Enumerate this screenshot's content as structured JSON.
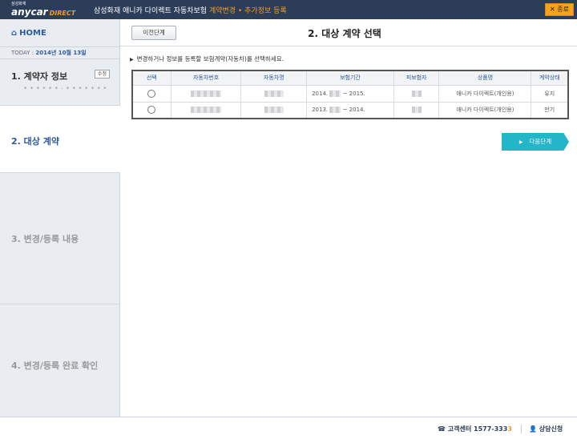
{
  "header": {
    "logo_top": "삼성화재",
    "logo_main": "anycar",
    "logo_sub": "DIRECT",
    "title": "삼성화재 애니카 다이렉트 자동차보험",
    "subtitle": "계약변경 • 추가정보 등록",
    "close_label": "종료"
  },
  "sidebar": {
    "home_label": "HOME",
    "today_label": "TODAY :",
    "today_date": "2014년 10월 13일",
    "steps": [
      {
        "label": "1. 계약자 정보",
        "badge": "수정",
        "masked": "* * * * * * · * * * * * * *"
      },
      {
        "label": "2. 대상 계약"
      },
      {
        "label": "3. 변경/등록 내용"
      },
      {
        "label": "4. 변경/등록 완료 확인"
      }
    ]
  },
  "main": {
    "prev_label": "이전단계",
    "title": "2. 대상 계약 선택",
    "instruction": "변경하거나 정보를 등록할 보험계약(자동차)를 선택하세요.",
    "table": {
      "headers": [
        "선택",
        "자동차번호",
        "자동차명",
        "보험기간",
        "피보험자",
        "상품명",
        "계약상태"
      ],
      "rows": [
        {
          "period_start": "2014.",
          "period_end": "~ 2015.",
          "product": "애니카 다이렉트(개인용)",
          "status": "유지"
        },
        {
          "period_start": "2013.",
          "period_end": "~ 2014.",
          "product": "애니카 다이렉트(개인용)",
          "status": "만기"
        }
      ]
    },
    "next_label": "다음단계"
  },
  "footer": {
    "cs_label": "고객센터",
    "cs_number_main": "1577-333",
    "cs_number_last": "3",
    "consult_label": "상담신청"
  },
  "colors": {
    "header_bg": "#2c3e57",
    "accent_orange": "#f39a28",
    "accent_teal": "#23b5c8",
    "link_blue": "#2c5aa0"
  }
}
